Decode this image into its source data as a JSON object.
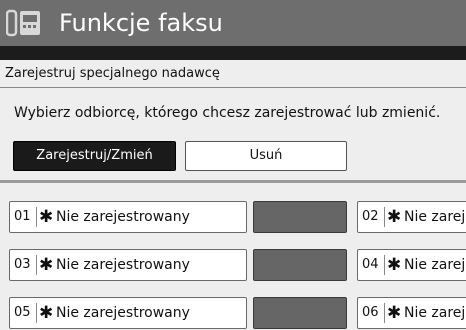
{
  "header": {
    "title": "Funkcje faksu",
    "icon": "fax-icon"
  },
  "panel": {
    "subtitle": "Zarejestruj specjalnego nadawcę",
    "instruction": "Wybierz odbiorcę, którego chcesz zarejestrować lub zmienić."
  },
  "actions": {
    "register_label": "Zarejestruj/Zmień",
    "delete_label": "Usuń"
  },
  "entries": [
    {
      "number": "01",
      "star": "✱",
      "name": "Nie zarejestrowany"
    },
    {
      "number": "02",
      "star": "✱",
      "name": "Nie zareje"
    },
    {
      "number": "03",
      "star": "✱",
      "name": "Nie zarejestrowany"
    },
    {
      "number": "04",
      "star": "✱",
      "name": "Nie zareje"
    },
    {
      "number": "05",
      "star": "✱",
      "name": "Nie zarejestrowany"
    },
    {
      "number": "06",
      "star": "✱",
      "name": "Nie zareje"
    }
  ],
  "colors": {
    "title_bar": "#6e6e6e",
    "panel_background": "#eeeeee",
    "selected_button": "#1a1a1a",
    "empty_slot": "#666666"
  }
}
